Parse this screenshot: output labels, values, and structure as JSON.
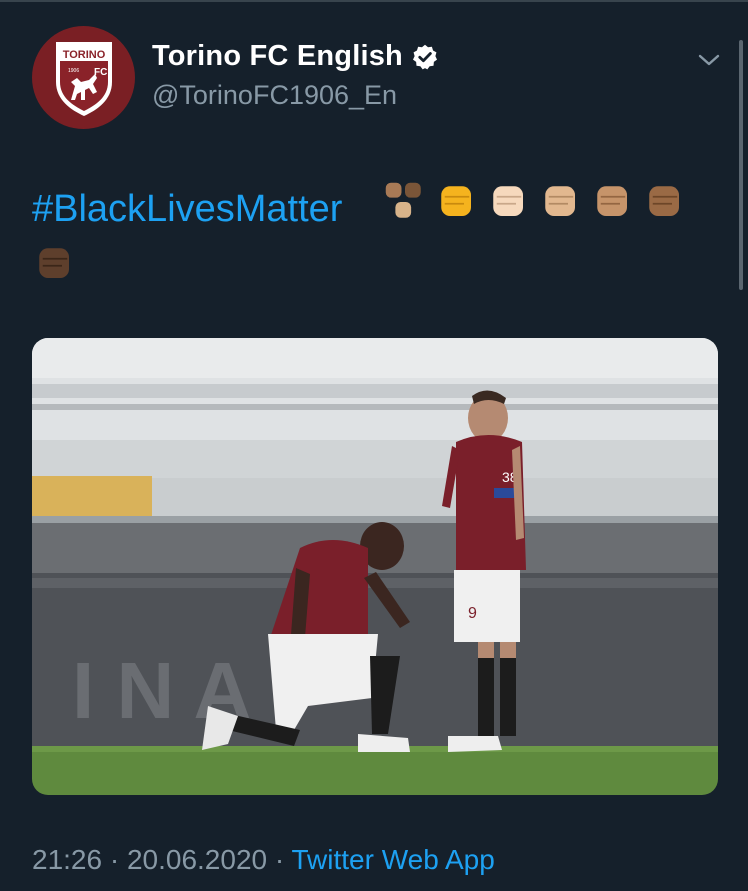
{
  "tweet": {
    "display_name": "Torino FC English",
    "handle": "@TorinoFC1906_En",
    "hashtag": "#BlackLivesMatter",
    "emoji": [
      "raised-fists-group",
      "fist-yellow",
      "fist-light",
      "fist-medium-light",
      "fist-medium",
      "fist-medium-dark",
      "fist-dark"
    ],
    "timestamp": "21:26 · 20.06.2020 · ",
    "source": "Twitter Web App"
  },
  "avatar": {
    "crest_top": "TORINO",
    "crest_year": "1906",
    "crest_fc": "FC"
  },
  "icons": {
    "verified": "verified-badge-icon",
    "menu": "chevron-down-icon"
  },
  "colors": {
    "background": "#15202b",
    "link": "#1da1f2",
    "secondary_text": "#8899a6",
    "club_maroon": "#7a1f24"
  },
  "media": {
    "player_back_number": "9"
  }
}
